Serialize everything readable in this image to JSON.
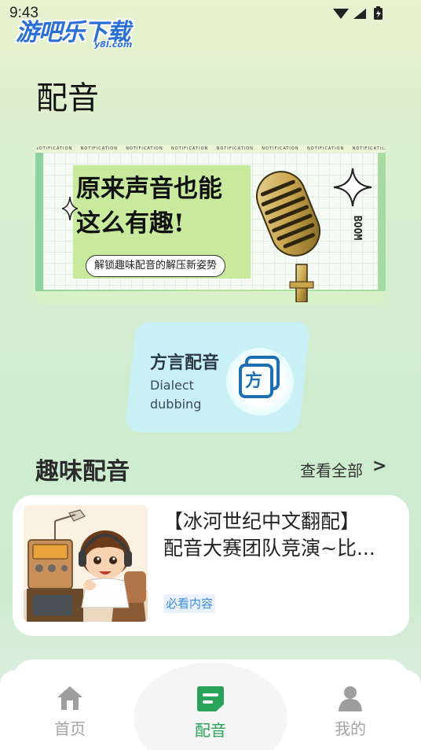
{
  "status": {
    "time": "9:43"
  },
  "watermark": {
    "text": "游吧乐下载",
    "sub": "y8l.com"
  },
  "page": {
    "title": "配音"
  },
  "banner": {
    "headline_line1": "原来声音也能",
    "headline_line2": "这么有趣!",
    "pill": "解锁趣味配音的解压新姿势",
    "strip_text": "NOTIFICATION",
    "side_text": "BOOM"
  },
  "dialect": {
    "title": "方言配音",
    "subtitle_line1": "Dialect",
    "subtitle_line2": "dubbing",
    "icon_char": "方"
  },
  "section": {
    "title": "趣味配音",
    "see_all": "查看全部",
    "arrow": ">"
  },
  "list": [
    {
      "title_line1": "【冰河世纪中文翻配】",
      "title_line2": "配音大赛团队竞演~比...",
      "tag": "必看内容"
    }
  ],
  "nav": {
    "items": [
      {
        "label": "首页",
        "icon": "home-icon",
        "active": false
      },
      {
        "label": "配音",
        "icon": "dubbing-icon",
        "active": true
      },
      {
        "label": "我的",
        "icon": "profile-icon",
        "active": false
      }
    ]
  },
  "colors": {
    "accent": "#2aa35a",
    "tag_bg": "#eaf3fd",
    "tag_text": "#3b8be0",
    "dialect_card": "#c9f0f5"
  }
}
